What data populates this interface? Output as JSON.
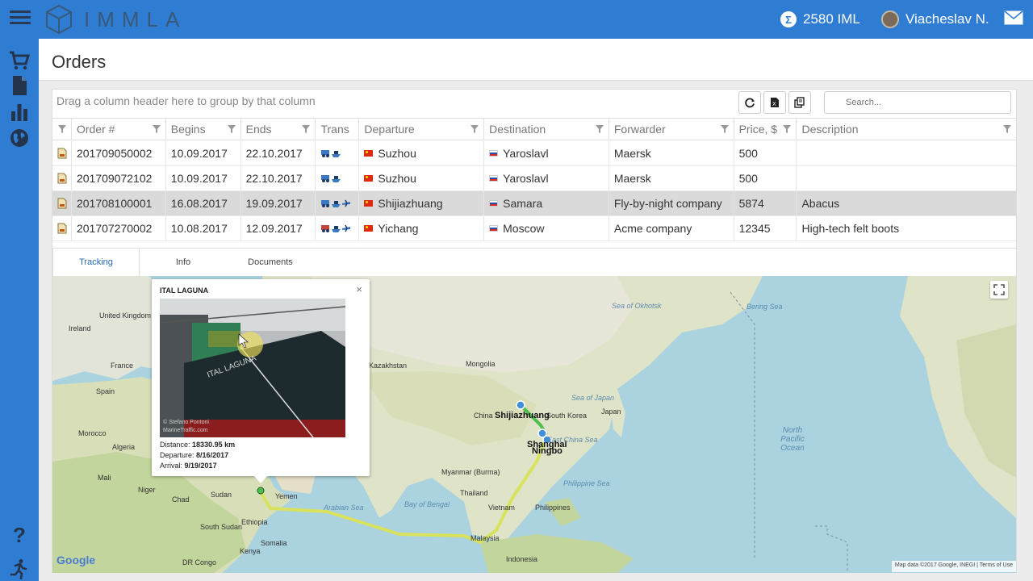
{
  "header": {
    "brand": "IMMLA",
    "balance": "2580 IML",
    "balance_symbol": "Σ",
    "user_name": "Viacheslav N.",
    "accent_color": "#2f7dd3"
  },
  "sidebar": {
    "items": [
      {
        "icon": "cart-icon"
      },
      {
        "icon": "document-icon"
      },
      {
        "icon": "bar-chart-icon"
      },
      {
        "icon": "globe-icon"
      },
      {
        "icon": "help-icon"
      },
      {
        "icon": "runner-icon"
      }
    ],
    "help_glyph": "?"
  },
  "page": {
    "title": "Orders"
  },
  "grid": {
    "group_hint": "Drag a column header here to group by that column",
    "search_placeholder": "Search...",
    "columns": [
      "Order #",
      "Begins",
      "Ends",
      "Trans",
      "Departure",
      "Destination",
      "Forwarder",
      "Price, $",
      "Description"
    ],
    "rows": [
      {
        "order": "201709050002",
        "begins": "10.09.2017",
        "ends": "22.10.2017",
        "departure": "Suzhou",
        "destination": "Yaroslavl",
        "forwarder": "Maersk",
        "price": "500",
        "description": ""
      },
      {
        "order": "201709072102",
        "begins": "10.09.2017",
        "ends": "22.10.2017",
        "departure": "Suzhou",
        "destination": "Yaroslavl",
        "forwarder": "Maersk",
        "price": "500",
        "description": ""
      },
      {
        "order": "201708100001",
        "begins": "16.08.2017",
        "ends": "19.09.2017",
        "departure": "Shijiazhuang",
        "destination": "Samara",
        "forwarder": "Fly-by-night company",
        "price": "5874",
        "description": "Abacus",
        "selected": true
      },
      {
        "order": "201707270002",
        "begins": "10.08.2017",
        "ends": "12.09.2017",
        "departure": "Yichang",
        "destination": "Moscow",
        "forwarder": "Acme company",
        "price": "12345",
        "description": "High-tech felt boots"
      }
    ]
  },
  "tabs": [
    {
      "label": "Tracking",
      "active": true
    },
    {
      "label": "Info"
    },
    {
      "label": "Documents"
    }
  ],
  "map": {
    "popup": {
      "vessel": "ITAL LAGUNA",
      "close": "×",
      "hull_text": "ITAL LAGUNA",
      "photo_credit_1": "© Stefano Pontoni",
      "photo_credit_2": "MarineTraffic.com",
      "distance_label": "Distance:",
      "distance_value": "18330.95 km",
      "departure_label": "Departure:",
      "departure_value": "8/16/2017",
      "arrival_label": "Arrival:",
      "arrival_value": "9/19/2017"
    },
    "cities": [
      "Shijiazhuang",
      "Shanghai",
      "Ningbo"
    ],
    "labels": {
      "united_kingdom": "United Kingdom",
      "ireland": "Ireland",
      "france": "France",
      "spain": "Spain",
      "morocco": "Morocco",
      "algeria": "Algeria",
      "mali": "Mali",
      "niger": "Niger",
      "chad": "Chad",
      "sudan": "Sudan",
      "south_sudan": "South Sudan",
      "ethiopia": "Ethiopia",
      "somalia": "Somalia",
      "kenya": "Kenya",
      "dr_congo": "DR Congo",
      "yemen": "Yemen",
      "mongolia": "Mongolia",
      "kazakhstan": "Kazakhstan",
      "china": "China",
      "south_korea": "South Korea",
      "japan": "Japan",
      "myanmar": "Myanmar (Burma)",
      "thailand": "Thailand",
      "vietnam": "Vietnam",
      "philippines": "Philippines",
      "malaysia": "Malaysia",
      "indonesia": "Indonesia",
      "sea_of_okhotsk": "Sea of Okhotsk",
      "sea_of_japan": "Sea of Japan",
      "east_china_sea": "East China Sea",
      "philippine_sea": "Philippine Sea",
      "bay_of_bengal": "Bay of Bengal",
      "arabian_sea": "Arabian Sea",
      "north_pacific_ocean": "North Pacific Ocean",
      "bering_sea": "Bering Sea"
    },
    "google_logo": "Google",
    "attribution": "Map data ©2017 Google, INEGI  |  Terms of Use"
  }
}
